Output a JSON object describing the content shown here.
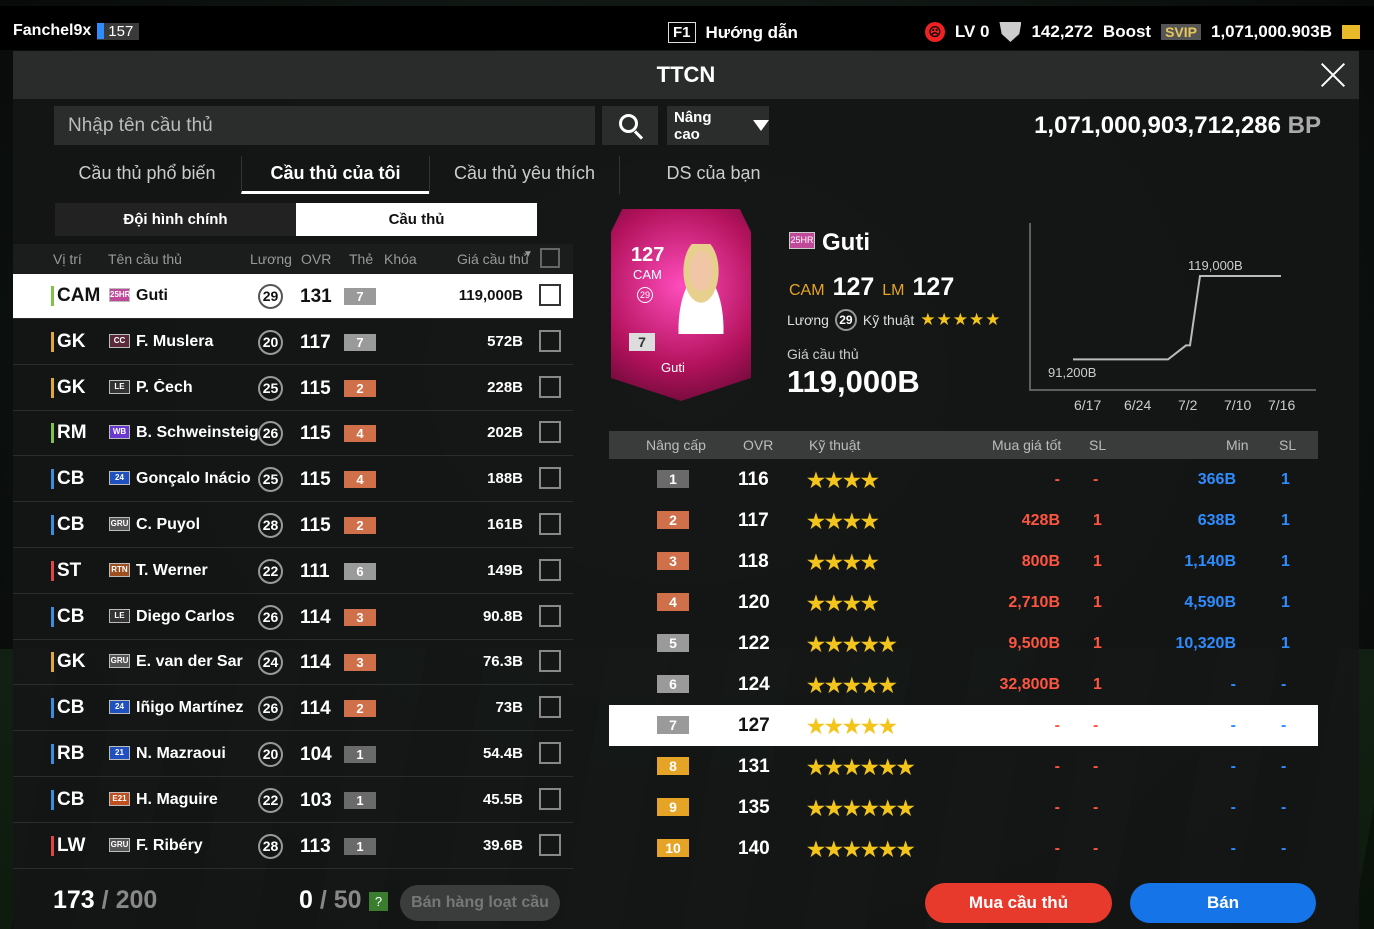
{
  "topbar": {
    "username": "Fanchel9x",
    "level": "157",
    "guide_key": "F1",
    "guide_label": "Hướng dẫn",
    "lv_label": "LV 0",
    "points": "142,272",
    "boost_label": "Boost",
    "svip_label": "SVIP",
    "balance": "1,071,000.903B"
  },
  "panel": {
    "title": "TTCN",
    "search_placeholder": "Nhập tên cầu thủ",
    "advanced_label": "Nâng cao",
    "bp_total": "1,071,000,903,712,286",
    "bp_unit": "BP"
  },
  "tabs": [
    {
      "label": "Cầu thủ phổ biến",
      "active": false
    },
    {
      "label": "Cầu thủ của tôi",
      "active": true
    },
    {
      "label": "Cầu thủ yêu thích",
      "active": false
    },
    {
      "label": "DS của bạn",
      "active": false
    }
  ],
  "subtabs": [
    {
      "label": "Đội hình chính",
      "active": false
    },
    {
      "label": "Cầu thủ",
      "active": true
    }
  ],
  "list_headers": {
    "pos": "Vị trí",
    "name": "Tên cầu thủ",
    "salary": "Lương",
    "ovr": "OVR",
    "card": "Thẻ",
    "lock": "Khóa",
    "price": "Giá cầu thủ"
  },
  "players": [
    {
      "pos": "CAM",
      "role": "mid",
      "season": "25HR",
      "season_color": "#c04a9a",
      "name": "Guti",
      "salary": "29",
      "ovr": "131",
      "grade": "7",
      "grade_color": "#9a9a9a",
      "price": "119,000B",
      "selected": true
    },
    {
      "pos": "GK",
      "role": "gk",
      "season": "CC",
      "season_color": "#5a2a3a",
      "name": "F. Muslera",
      "salary": "20",
      "ovr": "117",
      "grade": "7",
      "grade_color": "#9a9a9a",
      "price": "572B",
      "selected": false
    },
    {
      "pos": "GK",
      "role": "gk",
      "season": "LE",
      "season_color": "#333333",
      "name": "P. Čech",
      "salary": "25",
      "ovr": "115",
      "grade": "2",
      "grade_color": "#d0704a",
      "price": "228B",
      "selected": false
    },
    {
      "pos": "RM",
      "role": "mid",
      "season": "WB",
      "season_color": "#6a3ad0",
      "name": "B. Schweinsteiger",
      "salary": "26",
      "ovr": "115",
      "grade": "4",
      "grade_color": "#d0704a",
      "price": "202B",
      "selected": false
    },
    {
      "pos": "CB",
      "role": "def",
      "season": "24",
      "season_color": "#2050c0",
      "name": "Gonçalo Inácio",
      "salary": "25",
      "ovr": "115",
      "grade": "4",
      "grade_color": "#d0704a",
      "price": "188B",
      "selected": false
    },
    {
      "pos": "CB",
      "role": "def",
      "season": "GRU",
      "season_color": "#555555",
      "name": "C. Puyol",
      "salary": "28",
      "ovr": "115",
      "grade": "2",
      "grade_color": "#d0704a",
      "price": "161B",
      "selected": false
    },
    {
      "pos": "ST",
      "role": "att",
      "season": "RTN",
      "season_color": "#a05020",
      "name": "T. Werner",
      "salary": "22",
      "ovr": "111",
      "grade": "6",
      "grade_color": "#9a9a9a",
      "price": "149B",
      "selected": false
    },
    {
      "pos": "CB",
      "role": "def",
      "season": "LE",
      "season_color": "#333333",
      "name": "Diego Carlos",
      "salary": "26",
      "ovr": "114",
      "grade": "3",
      "grade_color": "#d0704a",
      "price": "90.8B",
      "selected": false
    },
    {
      "pos": "GK",
      "role": "gk",
      "season": "GRU",
      "season_color": "#555555",
      "name": "E. van der Sar",
      "salary": "24",
      "ovr": "114",
      "grade": "3",
      "grade_color": "#d0704a",
      "price": "76.3B",
      "selected": false
    },
    {
      "pos": "CB",
      "role": "def",
      "season": "24",
      "season_color": "#2050c0",
      "name": "Iñigo Martínez",
      "salary": "26",
      "ovr": "114",
      "grade": "2",
      "grade_color": "#d0704a",
      "price": "73B",
      "selected": false
    },
    {
      "pos": "RB",
      "role": "def",
      "season": "21",
      "season_color": "#2050c0",
      "name": "N. Mazraoui",
      "salary": "20",
      "ovr": "104",
      "grade": "1",
      "grade_color": "#6a6a6a",
      "price": "54.4B",
      "selected": false
    },
    {
      "pos": "CB",
      "role": "def",
      "season": "E21",
      "season_color": "#c05020",
      "name": "H. Maguire",
      "salary": "22",
      "ovr": "103",
      "grade": "1",
      "grade_color": "#6a6a6a",
      "price": "45.5B",
      "selected": false
    },
    {
      "pos": "LW",
      "role": "att",
      "season": "GRU",
      "season_color": "#555555",
      "name": "F. Ribéry",
      "salary": "28",
      "ovr": "113",
      "grade": "1",
      "grade_color": "#6a6a6a",
      "price": "39.6B",
      "selected": false
    }
  ],
  "footer": {
    "count": "173",
    "count_max": "200",
    "cart": "0",
    "cart_max": "50",
    "help": "?",
    "bulk_label": "Bán hàng loạt cầu thủ"
  },
  "detail": {
    "card_ovr": "127",
    "card_pos": "CAM",
    "card_salary": "29",
    "card_grade": "7",
    "card_name": "Guti",
    "season": "25HR",
    "name": "Guti",
    "pos1": "CAM",
    "ovr1": "127",
    "pos2": "LM",
    "ovr2": "127",
    "salary_label": "Lương",
    "salary": "29",
    "skill_label": "Kỹ thuật",
    "skill_stars": "★★★★★",
    "price_label": "Giá cầu thủ",
    "price": "119,000B"
  },
  "chart_data": {
    "type": "line",
    "x": [
      "6/17",
      "6/24",
      "7/2",
      "7/10",
      "7/16"
    ],
    "series": [
      {
        "values": [
          91200,
          91200,
          91200,
          119000,
          119000
        ]
      }
    ],
    "annotations": [
      "119,000B",
      "91,200B"
    ],
    "title": "",
    "xlabel": "",
    "ylabel": "",
    "grid": false
  },
  "upgrade_headers": {
    "level": "Nâng cấp",
    "ovr": "OVR",
    "skill": "Kỹ thuật",
    "best_buy": "Mua giá tốt",
    "sl1": "SL",
    "min": "Min",
    "sl2": "SL"
  },
  "upgrades": [
    {
      "level": "1",
      "color": "#6a6a6a",
      "ovr": "116",
      "stars": "★★★★",
      "buy": "-",
      "sl1": "-",
      "min": "366B",
      "sl2": "1",
      "selected": false
    },
    {
      "level": "2",
      "color": "#d0704a",
      "ovr": "117",
      "stars": "★★★★",
      "buy": "428B",
      "sl1": "1",
      "min": "638B",
      "sl2": "1",
      "selected": false
    },
    {
      "level": "3",
      "color": "#d0704a",
      "ovr": "118",
      "stars": "★★★★",
      "buy": "800B",
      "sl1": "1",
      "min": "1,140B",
      "sl2": "1",
      "selected": false
    },
    {
      "level": "4",
      "color": "#d0704a",
      "ovr": "120",
      "stars": "★★★★",
      "buy": "2,710B",
      "sl1": "1",
      "min": "4,590B",
      "sl2": "1",
      "selected": false
    },
    {
      "level": "5",
      "color": "#9a9a9a",
      "ovr": "122",
      "stars": "★★★★★",
      "buy": "9,500B",
      "sl1": "1",
      "min": "10,320B",
      "sl2": "1",
      "selected": false
    },
    {
      "level": "6",
      "color": "#9a9a9a",
      "ovr": "124",
      "stars": "★★★★★",
      "buy": "32,800B",
      "sl1": "1",
      "min": "-",
      "sl2": "-",
      "selected": false
    },
    {
      "level": "7",
      "color": "#9a9a9a",
      "ovr": "127",
      "stars": "★★★★★",
      "buy": "-",
      "sl1": "-",
      "min": "-",
      "sl2": "-",
      "selected": true
    },
    {
      "level": "8",
      "color": "#e6a427",
      "ovr": "131",
      "stars": "★★★★★★",
      "buy": "-",
      "sl1": "-",
      "min": "-",
      "sl2": "-",
      "selected": false
    },
    {
      "level": "9",
      "color": "#e6a427",
      "ovr": "135",
      "stars": "★★★★★★",
      "buy": "-",
      "sl1": "-",
      "min": "-",
      "sl2": "-",
      "selected": false
    },
    {
      "level": "10",
      "color": "#e6a427",
      "ovr": "140",
      "stars": "★★★★★★",
      "buy": "-",
      "sl1": "-",
      "min": "-",
      "sl2": "-",
      "selected": false
    }
  ],
  "actions": {
    "buy_label": "Mua cầu thủ",
    "sell_label": "Bán"
  }
}
